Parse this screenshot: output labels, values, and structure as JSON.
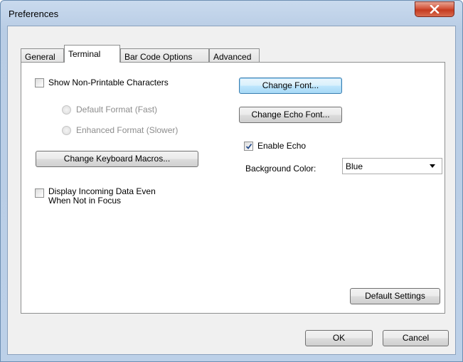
{
  "window": {
    "title": "Preferences"
  },
  "tabs": [
    {
      "label": "General",
      "selected": false
    },
    {
      "label": "Terminal",
      "selected": true
    },
    {
      "label": "Bar Code Options",
      "selected": false
    },
    {
      "label": "Advanced",
      "selected": false
    }
  ],
  "terminal": {
    "show_nonprintable": {
      "label": "Show Non-Printable Characters",
      "checked": false
    },
    "format_options": [
      {
        "label": "Default Format (Fast)",
        "enabled": false
      },
      {
        "label": "Enhanced Format (Slower)",
        "enabled": false
      }
    ],
    "macros_button": "Change Keyboard Macros...",
    "display_incoming": {
      "label_line1": "Display Incoming Data Even",
      "label_line2": "When Not in Focus",
      "checked": false
    },
    "change_font_button": "Change Font...",
    "change_echo_font_button": "Change Echo Font...",
    "enable_echo": {
      "label": "Enable Echo",
      "checked": true
    },
    "background_color": {
      "label": "Background Color:",
      "value": "Blue"
    },
    "default_settings_button": "Default Settings"
  },
  "footer": {
    "ok_label": "OK",
    "cancel_label": "Cancel"
  },
  "colors": {
    "titlebar": "#b9d1ea",
    "close_button": "#c9462c",
    "focus_border": "#3c7fb1"
  }
}
